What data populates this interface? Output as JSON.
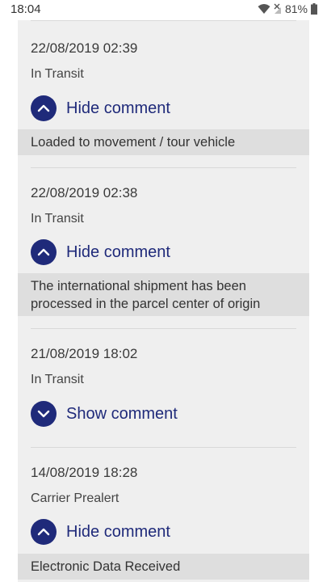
{
  "status_bar": {
    "time": "18:04",
    "battery": "81%"
  },
  "events": [
    {
      "date": "22/08/2019 02:39",
      "status": "In Transit",
      "toggle_label": "Hide comment",
      "comment": "Loaded to movement / tour vehicle"
    },
    {
      "date": "22/08/2019 02:38",
      "status": "In Transit",
      "toggle_label": "Hide comment",
      "comment": "The international shipment has been processed in the parcel center of origin"
    },
    {
      "date": "21/08/2019 18:02",
      "status": "In Transit",
      "toggle_label": "Show comment"
    },
    {
      "date": "14/08/2019 18:28",
      "status": "Carrier Prealert",
      "toggle_label": "Hide comment",
      "comment": "Electronic Data Received"
    }
  ],
  "icons": {
    "hide": "chevron-up-icon",
    "show": "chevron-down-icon"
  },
  "colors": {
    "accent": "#1f2a7a",
    "panel_bg": "#efefef",
    "comment_bg": "#dedede"
  }
}
